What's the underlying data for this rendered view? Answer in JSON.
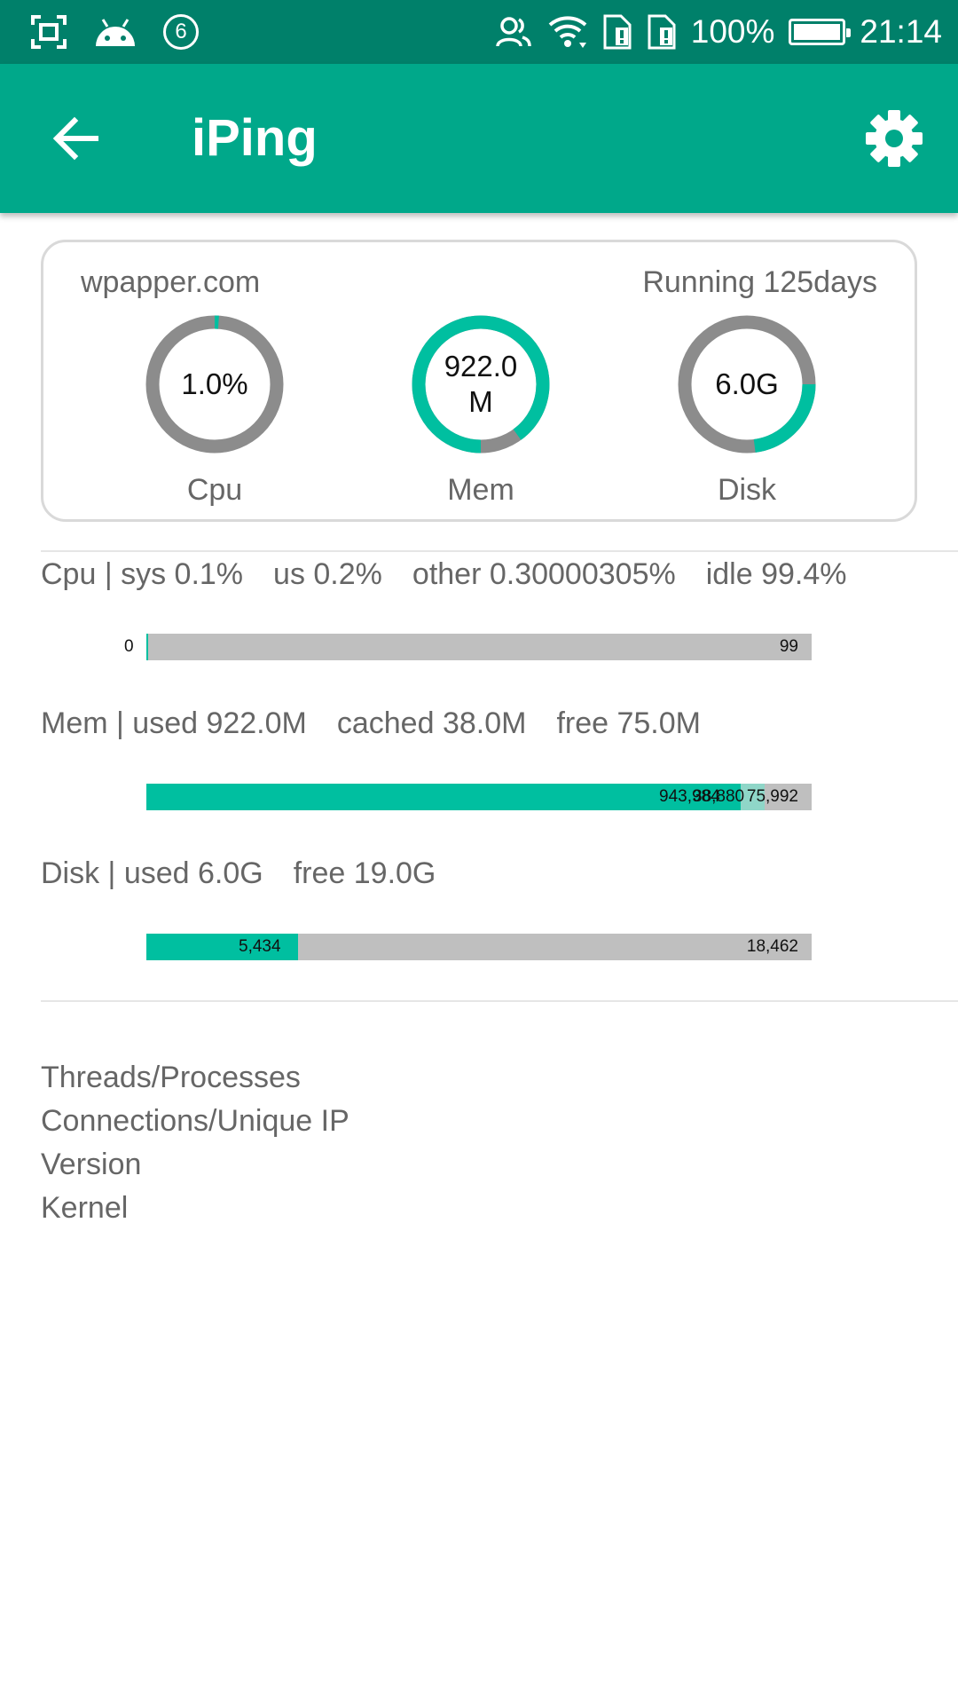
{
  "status_bar": {
    "notification_count": "6",
    "battery": "100%",
    "time": "21:14",
    "icons": [
      "screenshot-icon",
      "android-icon",
      "notification-count-icon",
      "contacts-icon",
      "wifi-icon",
      "sim1-icon",
      "sim2-icon",
      "battery-icon"
    ]
  },
  "app_bar": {
    "title": "iPing",
    "back_icon": "arrow-back-icon",
    "settings_icon": "gear-icon"
  },
  "colors": {
    "status_bar": "#00806a",
    "app_bar": "#00a88a",
    "accent": "#00bfa0",
    "gauge_track": "#8c8c8c",
    "bar_bg": "#bfbfbf",
    "cached": "#8fd6c8"
  },
  "summary": {
    "host": "wpapper.com",
    "uptime": "Running 125days",
    "gauges": [
      {
        "label": "Cpu",
        "value": "1.0%",
        "fraction": 0.01
      },
      {
        "label": "Mem",
        "value": "922.0 M",
        "fraction": 0.9
      },
      {
        "label": "Disk",
        "value": "6.0G",
        "fraction": 0.23
      }
    ]
  },
  "cpu": {
    "heading": "Cpu | sys 0.1%",
    "us": "us 0.2%",
    "other": "other 0.30000305%",
    "idle": "idle 99.4%",
    "bar": {
      "used_label": "0",
      "idle_label": "99",
      "used_value": 0,
      "idle_value": 99
    }
  },
  "mem": {
    "heading": "Mem | used 922.0M",
    "cached": "cached 38.0M",
    "free": "free 75.0M",
    "bar": {
      "used_label": "943,984",
      "cached_label": "38,880",
      "free_label": "75,992",
      "used_value": 943984,
      "cached_value": 38880,
      "free_value": 75992
    }
  },
  "disk": {
    "heading": "Disk | used 6.0G",
    "free": "free 19.0G",
    "bar": {
      "used_label": "5,434",
      "free_label": "18,462",
      "used_value": 5434,
      "free_value": 18462
    }
  },
  "info": {
    "threads": "Threads/Processes",
    "connections": "Connections/Unique IP",
    "version": "Version",
    "kernel": "Kernel"
  }
}
